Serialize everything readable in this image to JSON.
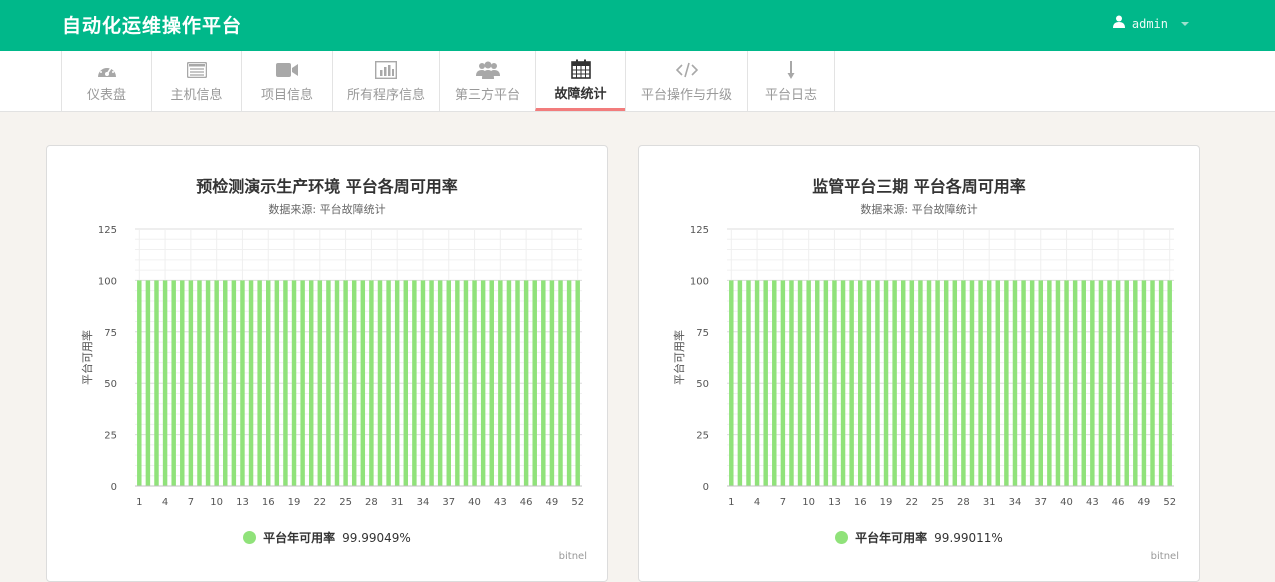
{
  "header": {
    "title": "自动化运维操作平台",
    "user_name": "admin",
    "user_icon": "user-icon"
  },
  "nav": {
    "tabs": [
      {
        "label": "仪表盘",
        "icon": "dashboard-icon"
      },
      {
        "label": "主机信息",
        "icon": "list-icon"
      },
      {
        "label": "项目信息",
        "icon": "video-camera-icon"
      },
      {
        "label": "所有程序信息",
        "icon": "bar-chart-icon"
      },
      {
        "label": "第三方平台",
        "icon": "users-icon"
      },
      {
        "label": "故障统计",
        "icon": "calendar-icon",
        "active": true
      },
      {
        "label": "平台操作与升级",
        "icon": "code-icon"
      },
      {
        "label": "平台日志",
        "icon": "arrow-down-icon"
      }
    ]
  },
  "colors": {
    "header_bg": "#00b88a",
    "bar": "#90e27a",
    "active_tab_underline": "#f27c7c"
  },
  "chart_data": [
    {
      "type": "bar",
      "title": "预检测演示生产环境 平台各周可用率",
      "subtitle": "数据来源: 平台故障统计",
      "xlabel": "",
      "ylabel": "平台可用率",
      "ylim": [
        0,
        125
      ],
      "yticks": [
        "0",
        "25",
        "50",
        "75",
        "100",
        "125"
      ],
      "xtick_labels": [
        "1",
        "4",
        "7",
        "10",
        "13",
        "16",
        "19",
        "22",
        "25",
        "28",
        "31",
        "34",
        "37",
        "40",
        "43",
        "46",
        "49",
        "52"
      ],
      "categories": [
        "1",
        "2",
        "3",
        "4",
        "5",
        "6",
        "7",
        "8",
        "9",
        "10",
        "11",
        "12",
        "13",
        "14",
        "15",
        "16",
        "17",
        "18",
        "19",
        "20",
        "21",
        "22",
        "23",
        "24",
        "25",
        "26",
        "27",
        "28",
        "29",
        "30",
        "31",
        "32",
        "33",
        "34",
        "35",
        "36",
        "37",
        "38",
        "39",
        "40",
        "41",
        "42",
        "43",
        "44",
        "45",
        "46",
        "47",
        "48",
        "49",
        "50",
        "51",
        "52"
      ],
      "series": [
        {
          "name": "平台年可用率",
          "legend_value": "99.99049%",
          "values": [
            100,
            100,
            100,
            100,
            100,
            100,
            100,
            100,
            100,
            100,
            100,
            100,
            100,
            100,
            100,
            100,
            100,
            100,
            100,
            100,
            100,
            100,
            100,
            100,
            100,
            100,
            100,
            100,
            100,
            100,
            100,
            100,
            100,
            100,
            100,
            100,
            100,
            100,
            100,
            100,
            100,
            100,
            100,
            100,
            100,
            100,
            100,
            100,
            100,
            100,
            100,
            100
          ]
        }
      ],
      "grid": true,
      "legend": "bottom-center",
      "credit": "bitnel"
    },
    {
      "type": "bar",
      "title": "监管平台三期 平台各周可用率",
      "subtitle": "数据来源: 平台故障统计",
      "xlabel": "",
      "ylabel": "平台可用率",
      "ylim": [
        0,
        125
      ],
      "yticks": [
        "0",
        "25",
        "50",
        "75",
        "100",
        "125"
      ],
      "xtick_labels": [
        "1",
        "4",
        "7",
        "10",
        "13",
        "16",
        "19",
        "22",
        "25",
        "28",
        "31",
        "34",
        "37",
        "40",
        "43",
        "46",
        "49",
        "52"
      ],
      "categories": [
        "1",
        "2",
        "3",
        "4",
        "5",
        "6",
        "7",
        "8",
        "9",
        "10",
        "11",
        "12",
        "13",
        "14",
        "15",
        "16",
        "17",
        "18",
        "19",
        "20",
        "21",
        "22",
        "23",
        "24",
        "25",
        "26",
        "27",
        "28",
        "29",
        "30",
        "31",
        "32",
        "33",
        "34",
        "35",
        "36",
        "37",
        "38",
        "39",
        "40",
        "41",
        "42",
        "43",
        "44",
        "45",
        "46",
        "47",
        "48",
        "49",
        "50",
        "51",
        "52"
      ],
      "series": [
        {
          "name": "平台年可用率",
          "legend_value": "99.99011%",
          "values": [
            100,
            100,
            100,
            100,
            100,
            100,
            100,
            100,
            100,
            100,
            100,
            100,
            100,
            100,
            100,
            100,
            100,
            100,
            100,
            100,
            100,
            100,
            100,
            100,
            100,
            100,
            100,
            100,
            100,
            100,
            100,
            100,
            100,
            100,
            100,
            100,
            100,
            100,
            100,
            100,
            100,
            100,
            100,
            100,
            100,
            100,
            100,
            100,
            100,
            100,
            100,
            100
          ]
        }
      ],
      "grid": true,
      "legend": "bottom-center",
      "credit": "bitnel"
    }
  ]
}
